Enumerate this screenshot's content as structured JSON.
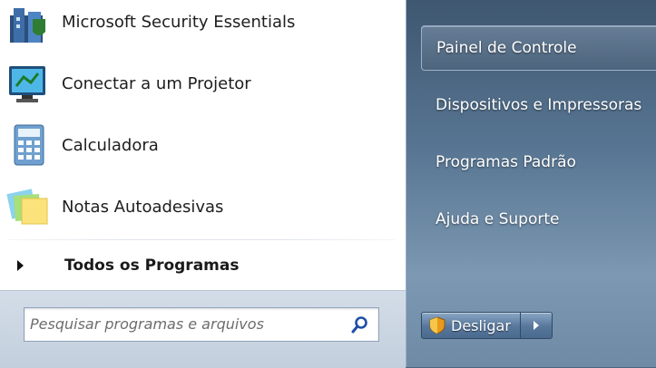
{
  "programs": [
    {
      "label": "Microsoft Security Essentials",
      "icon": "security-essentials-icon"
    },
    {
      "label": "Conectar a um Projetor",
      "icon": "projector-icon"
    },
    {
      "label": "Calculadora",
      "icon": "calculator-icon"
    },
    {
      "label": "Notas Autoadesivas",
      "icon": "sticky-notes-icon"
    }
  ],
  "all_programs": {
    "label": "Todos os Programas"
  },
  "search": {
    "placeholder": "Pesquisar programas e arquivos"
  },
  "right_items": [
    {
      "label": "Painel de Controle"
    },
    {
      "label": "Dispositivos e Impressoras"
    },
    {
      "label": "Programas Padrão"
    },
    {
      "label": "Ajuda e Suporte"
    }
  ],
  "shutdown": {
    "label": "Desligar"
  },
  "colors": {
    "accent": "#4a6680",
    "search_icon": "#1d4fa5",
    "shield": "#e89a1c"
  }
}
